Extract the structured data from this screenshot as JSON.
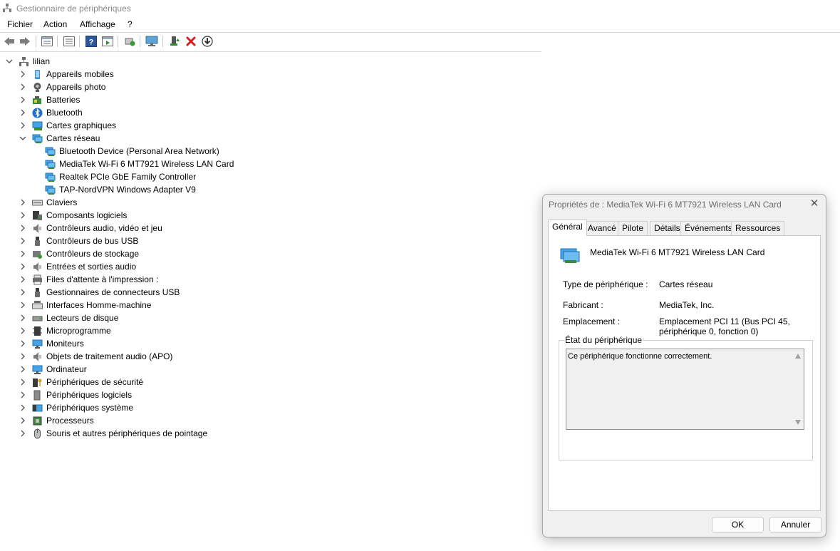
{
  "window": {
    "title": "Gestionnaire de périphériques"
  },
  "menu": [
    "Fichier",
    "Action",
    "Affichage",
    "?"
  ],
  "toolbar": {
    "icons": [
      "back-arrow-icon",
      "forward-arrow-icon",
      "properties-grid-icon",
      "list-view-icon",
      "help-icon",
      "run-icon",
      "scan-hardware-icon",
      "monitor-icon",
      "enable-device-icon",
      "uninstall-x-icon",
      "download-driver-icon"
    ]
  },
  "tree": {
    "root": "lilian",
    "items": [
      {
        "label": "Appareils mobiles",
        "icon": "mobile-device-icon",
        "expanded": false
      },
      {
        "label": "Appareils photo",
        "icon": "camera-icon",
        "expanded": false
      },
      {
        "label": "Batteries",
        "icon": "battery-icon",
        "expanded": false
      },
      {
        "label": "Bluetooth",
        "icon": "bluetooth-icon",
        "expanded": false
      },
      {
        "label": "Cartes graphiques",
        "icon": "display-adapter-icon",
        "expanded": false
      },
      {
        "label": "Cartes réseau",
        "icon": "network-adapter-icon",
        "expanded": true,
        "children": [
          {
            "label": "Bluetooth Device (Personal Area Network)",
            "icon": "network-adapter-icon"
          },
          {
            "label": "MediaTek Wi-Fi 6 MT7921 Wireless LAN Card",
            "icon": "network-adapter-icon"
          },
          {
            "label": "Realtek PCIe GbE Family Controller",
            "icon": "network-adapter-icon"
          },
          {
            "label": "TAP-NordVPN Windows Adapter V9",
            "icon": "network-adapter-icon"
          }
        ]
      },
      {
        "label": "Claviers",
        "icon": "keyboard-icon",
        "expanded": false
      },
      {
        "label": "Composants logiciels",
        "icon": "software-component-icon",
        "expanded": false
      },
      {
        "label": "Contrôleurs audio, vidéo et jeu",
        "icon": "speaker-icon",
        "expanded": false
      },
      {
        "label": "Contrôleurs de bus USB",
        "icon": "usb-icon",
        "expanded": false
      },
      {
        "label": "Contrôleurs de stockage",
        "icon": "storage-controller-icon",
        "expanded": false
      },
      {
        "label": "Entrées et sorties audio",
        "icon": "speaker-icon",
        "expanded": false
      },
      {
        "label": "Files d'attente à l'impression :",
        "icon": "printer-icon",
        "expanded": false
      },
      {
        "label": "Gestionnaires de connecteurs USB",
        "icon": "usb-icon",
        "expanded": false
      },
      {
        "label": "Interfaces Homme-machine",
        "icon": "hid-icon",
        "expanded": false
      },
      {
        "label": "Lecteurs de disque",
        "icon": "disk-drive-icon",
        "expanded": false
      },
      {
        "label": "Microprogramme",
        "icon": "firmware-icon",
        "expanded": false
      },
      {
        "label": "Moniteurs",
        "icon": "monitor-icon",
        "expanded": false
      },
      {
        "label": "Objets de traitement audio (APO)",
        "icon": "speaker-icon",
        "expanded": false
      },
      {
        "label": "Ordinateur",
        "icon": "computer-icon",
        "expanded": false
      },
      {
        "label": "Périphériques de sécurité",
        "icon": "security-key-icon",
        "expanded": false
      },
      {
        "label": "Périphériques logiciels",
        "icon": "software-device-icon",
        "expanded": false
      },
      {
        "label": "Périphériques système",
        "icon": "system-device-icon",
        "expanded": false
      },
      {
        "label": "Processeurs",
        "icon": "processor-icon",
        "expanded": false
      },
      {
        "label": "Souris et autres périphériques de pointage",
        "icon": "mouse-icon",
        "expanded": false
      }
    ]
  },
  "dialog": {
    "title": "Propriétés de : MediaTek Wi-Fi 6 MT7921 Wireless LAN Card",
    "tabs": [
      "Général",
      "Avancé",
      "Pilote",
      "Détails",
      "Événements",
      "Ressources"
    ],
    "active_tab": "Général",
    "device_name": "MediaTek Wi-Fi 6 MT7921 Wireless LAN Card",
    "type_label": "Type de périphérique :",
    "type_value": "Cartes réseau",
    "manufacturer_label": "Fabricant :",
    "manufacturer_value": "MediaTek, Inc.",
    "location_label": "Emplacement :",
    "location_value_line1": "Emplacement PCI 11 (Bus PCI 45,",
    "location_value_line2": "périphérique 0, fonction 0)",
    "status_group": "État du périphérique",
    "status_text": "Ce périphérique fonctionne correctement.",
    "ok_label": "OK",
    "cancel_label": "Annuler"
  },
  "colors": {
    "accent": "#0078d4",
    "network_icon": "#1e90ff",
    "uninstall_red": "#d81e1e",
    "help_blue": "#2b579a"
  }
}
